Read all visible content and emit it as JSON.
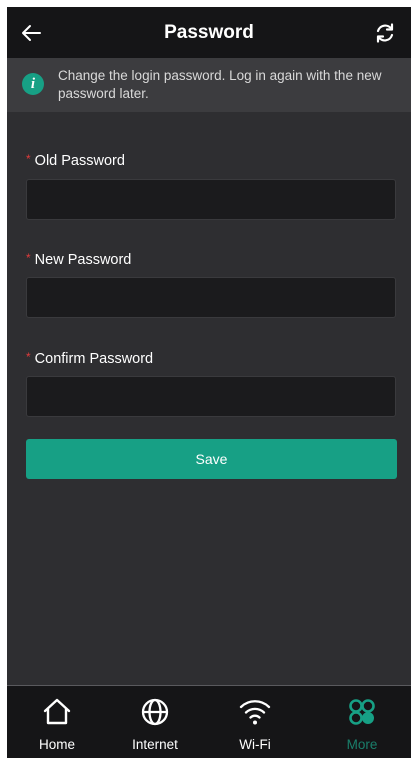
{
  "header": {
    "title": "Password",
    "back_icon": "arrow-left-icon",
    "refresh_icon": "refresh-icon"
  },
  "notice": {
    "icon": "info-icon",
    "icon_glyph": "i",
    "text": "Change the login password. Log in again with the new password later."
  },
  "form": {
    "required_marker": "*",
    "fields": [
      {
        "label": "Old Password",
        "value": "",
        "placeholder": ""
      },
      {
        "label": "New Password",
        "value": "",
        "placeholder": ""
      },
      {
        "label": "Confirm Password",
        "value": "",
        "placeholder": ""
      }
    ],
    "save_label": "Save"
  },
  "bottom_nav": {
    "items": [
      {
        "label": "Home",
        "icon": "home-icon",
        "active": false
      },
      {
        "label": "Internet",
        "icon": "globe-icon",
        "active": false
      },
      {
        "label": "Wi-Fi",
        "icon": "wifi-icon",
        "active": false
      },
      {
        "label": "More",
        "icon": "more-grid-icon",
        "active": true
      }
    ]
  },
  "colors": {
    "accent": "#17a085",
    "background": "#2e2e31",
    "header": "#151517",
    "required": "#e03b3b",
    "active_nav": "#1a7f6b"
  }
}
